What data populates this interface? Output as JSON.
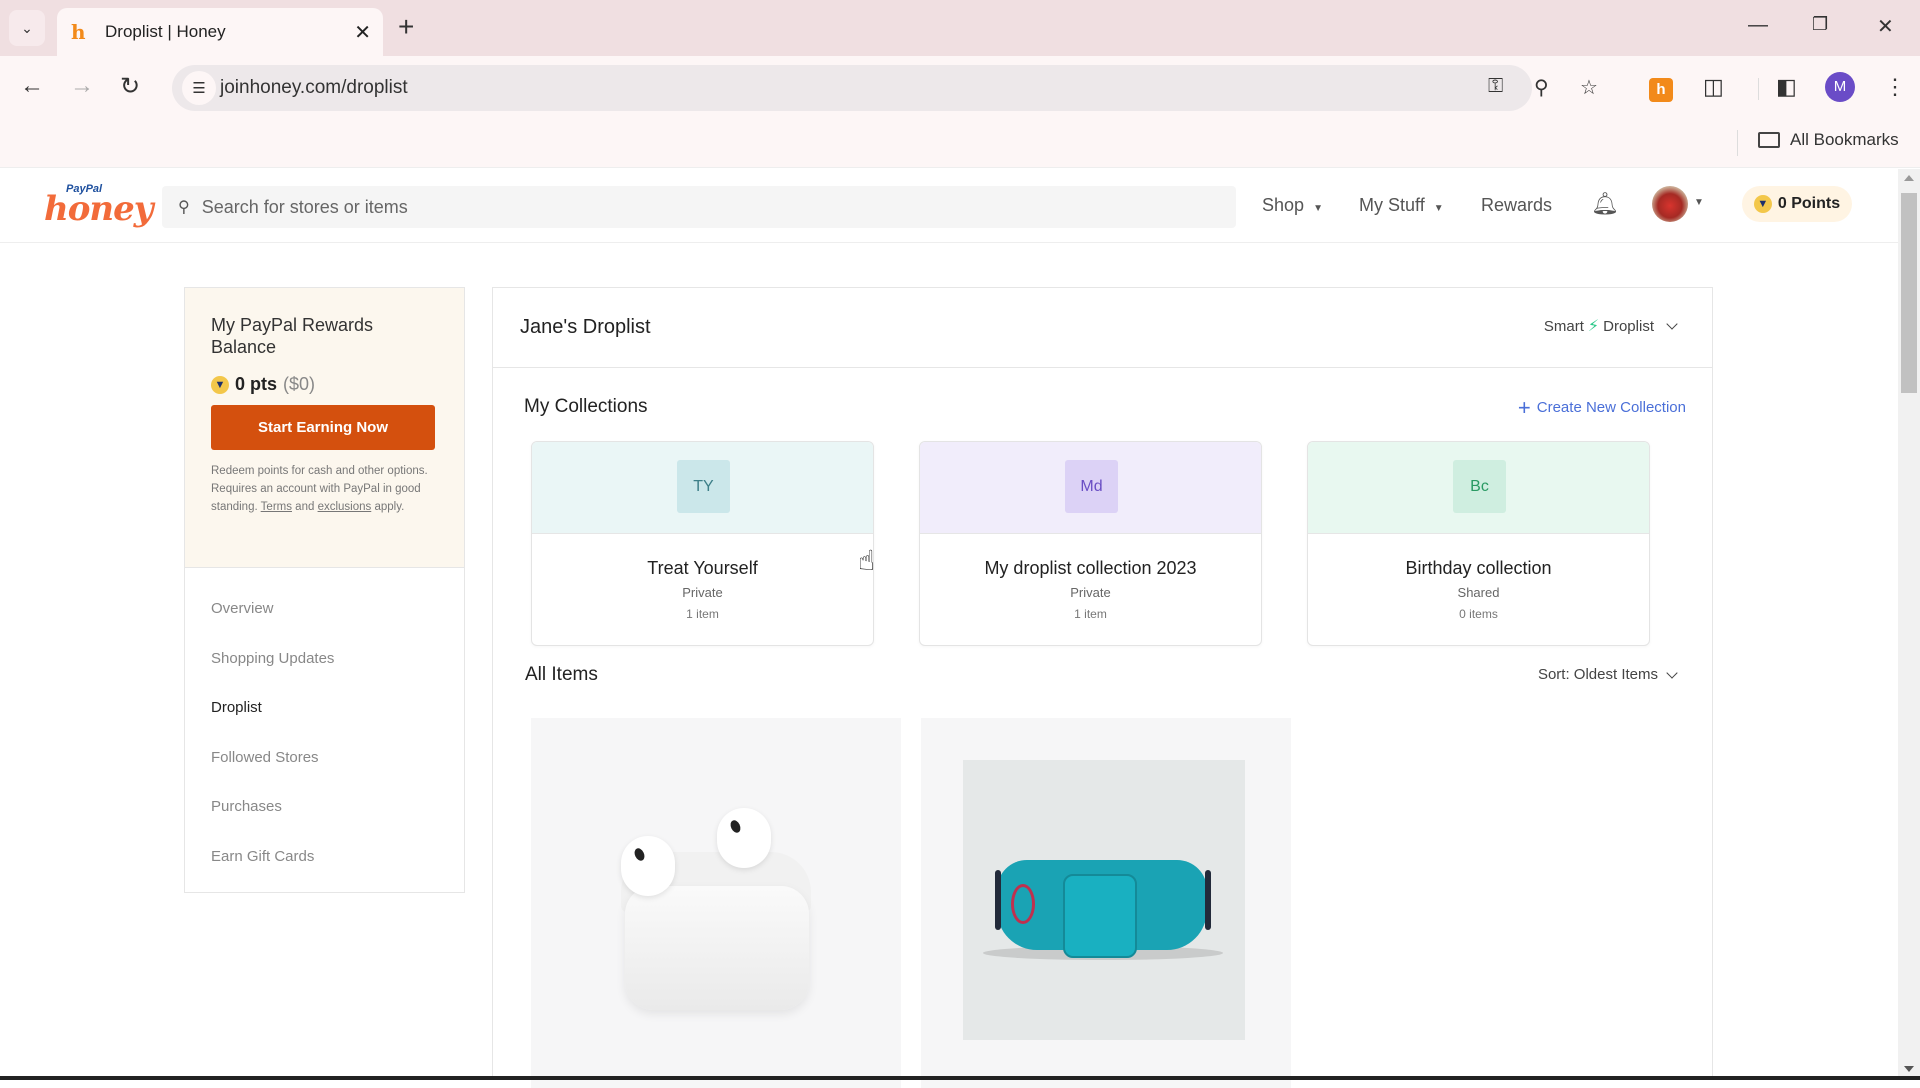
{
  "browser": {
    "tab": {
      "title": "Droplist | Honey",
      "favicon": "honey-h-icon"
    },
    "url": "joinhoney.com/droplist",
    "profile_initial": "M",
    "bookmarks": {
      "all_bookmarks_label": "All Bookmarks"
    },
    "icons": [
      "tab-search-icon",
      "close-icon",
      "new-tab-icon",
      "minimize-icon",
      "restore-icon",
      "window-close-icon",
      "back-icon",
      "forward-icon",
      "reload-icon",
      "site-info-icon",
      "password-key-icon",
      "zoom-out-icon",
      "bookmark-star-icon",
      "honey-extension-icon",
      "extensions-puzzle-icon",
      "side-panel-icon",
      "menu-kebab-icon",
      "folder-icon"
    ]
  },
  "site_header": {
    "logo_paypal": "PayPal",
    "logo_honey": "honey",
    "search_placeholder": "Search for stores or items",
    "nav": [
      {
        "label": "Shop",
        "has_dropdown": true
      },
      {
        "label": "My Stuff",
        "has_dropdown": true
      },
      {
        "label": "Rewards",
        "has_dropdown": false
      }
    ],
    "points_label": "0 Points"
  },
  "sidebar": {
    "rewards": {
      "title": "My PayPal Rewards Balance",
      "points": "0 pts",
      "dollars": "($0)",
      "cta": "Start Earning Now",
      "note_prefix": "Redeem points for cash and other options. Requires an account with PayPal in good standing. ",
      "terms_link": "Terms",
      "note_and": " and ",
      "exclusions_link": "exclusions",
      "note_suffix": " apply."
    },
    "items": [
      {
        "label": "Overview",
        "active": false
      },
      {
        "label": "Shopping Updates",
        "active": false
      },
      {
        "label": "Droplist",
        "active": true
      },
      {
        "label": "Followed Stores",
        "active": false
      },
      {
        "label": "Purchases",
        "active": false
      },
      {
        "label": "Earn Gift Cards",
        "active": false
      }
    ]
  },
  "main": {
    "title": "Jane's Droplist",
    "mode_dropdown": {
      "left": "Smart",
      "right": "Droplist"
    },
    "collections_title": "My Collections",
    "create_collection": "Create New Collection",
    "collections": [
      {
        "initials": "TY",
        "name": "Treat Yourself",
        "privacy": "Private",
        "count": "1 item",
        "bg": "#eaf6f6",
        "badge_bg": "#cbe7ea",
        "badge_fg": "#3d7f88"
      },
      {
        "initials": "Md",
        "name": "My droplist collection 2023",
        "privacy": "Private",
        "count": "1 item",
        "bg": "#f1edfb",
        "badge_bg": "#dcd2f6",
        "badge_fg": "#6a4fc4"
      },
      {
        "initials": "Bc",
        "name": "Birthday collection",
        "privacy": "Shared",
        "count": "0 items",
        "bg": "#e8f8f0",
        "badge_bg": "#cfeee0",
        "badge_fg": "#2a9a63"
      }
    ],
    "all_items_title": "All Items",
    "sort_label": "Sort: Oldest Items",
    "items": [
      {
        "product": "white wireless earbuds in charging case"
      },
      {
        "product": "teal waist bag"
      }
    ]
  }
}
